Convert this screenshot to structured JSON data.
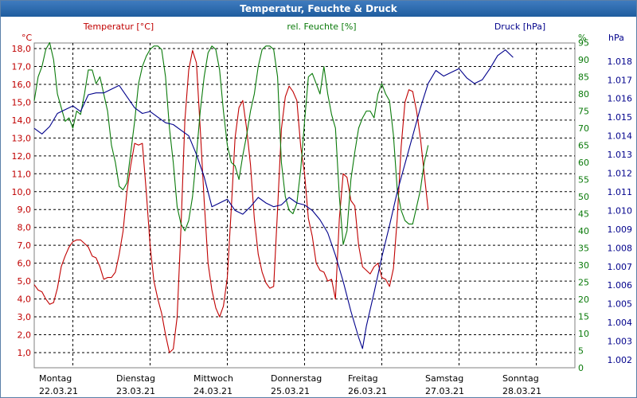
{
  "window": {
    "title": "Temperatur, Feuchte & Druck"
  },
  "colors": {
    "temp": "#c00000",
    "hum": "#0a7a0a",
    "press": "#00008b",
    "grid": "#000000"
  },
  "chart_data": {
    "type": "line",
    "title": "Temperatur, Feuchte & Druck",
    "grid": true,
    "x_range": [
      0,
      7
    ],
    "x_ticks": [
      {
        "day": "Montag",
        "date": "22.03.21",
        "x": 0
      },
      {
        "day": "Dienstag",
        "date": "23.03.21",
        "x": 1
      },
      {
        "day": "Mittwoch",
        "date": "24.03.21",
        "x": 2
      },
      {
        "day": "Donnerstag",
        "date": "25.03.21",
        "x": 3
      },
      {
        "day": "Freitag",
        "date": "26.03.21",
        "x": 4
      },
      {
        "day": "Samstag",
        "date": "27.03.21",
        "x": 5
      },
      {
        "day": "Sonntag",
        "date": "28.03.21",
        "x": 6
      }
    ],
    "axes": {
      "temp": {
        "unit": "°C",
        "label": "Temperatur [°C]",
        "range": [
          0.5,
          18.5
        ],
        "ticks": [
          "1,0",
          "2,0",
          "3,0",
          "4,0",
          "5,0",
          "6,0",
          "7,0",
          "8,0",
          "9,0",
          "10,0",
          "11,0",
          "12,0",
          "13,0",
          "14,0",
          "15,0",
          "16,0",
          "17,0",
          "18,0"
        ]
      },
      "hum": {
        "unit": "%",
        "label": "rel. Feuchte [%]",
        "range": [
          0,
          97
        ],
        "ticks": [
          "0",
          "5",
          "10",
          "15",
          "20",
          "25",
          "30",
          "35",
          "40",
          "45",
          "50",
          "55",
          "60",
          "65",
          "70",
          "75",
          "80",
          "85",
          "90",
          "95"
        ]
      },
      "press": {
        "unit": "hPa",
        "label": "Druck [hPa]",
        "range": [
          1001.6,
          1019.4
        ],
        "ticks": [
          "1.002",
          "1.003",
          "1.004",
          "1.005",
          "1.006",
          "1.007",
          "1.008",
          "1.009",
          "1.010",
          "1.011",
          "1.012",
          "1.013",
          "1.014",
          "1.015",
          "1.016",
          "1.017",
          "1.018"
        ]
      }
    },
    "series": [
      {
        "name": "Temperatur [°C]",
        "axis": "temp",
        "points": [
          [
            0,
            4.8
          ],
          [
            0.05,
            4.5
          ],
          [
            0.1,
            4.4
          ],
          [
            0.15,
            4.0
          ],
          [
            0.2,
            3.7
          ],
          [
            0.25,
            3.8
          ],
          [
            0.3,
            4.6
          ],
          [
            0.35,
            5.8
          ],
          [
            0.4,
            6.4
          ],
          [
            0.45,
            6.9
          ],
          [
            0.5,
            7.2
          ],
          [
            0.55,
            7.3
          ],
          [
            0.6,
            7.3
          ],
          [
            0.65,
            7.1
          ],
          [
            0.7,
            6.9
          ],
          [
            0.75,
            6.4
          ],
          [
            0.8,
            6.3
          ],
          [
            0.85,
            5.8
          ],
          [
            0.9,
            5.1
          ],
          [
            0.95,
            5.2
          ],
          [
            1.0,
            5.2
          ],
          [
            1.05,
            5.5
          ],
          [
            1.1,
            6.5
          ],
          [
            1.15,
            7.8
          ],
          [
            1.2,
            10.0
          ],
          [
            1.25,
            11.5
          ],
          [
            1.3,
            12.7
          ],
          [
            1.35,
            12.6
          ],
          [
            1.4,
            12.7
          ],
          [
            1.45,
            10.0
          ],
          [
            1.5,
            7.0
          ],
          [
            1.55,
            5.0
          ],
          [
            1.6,
            4.0
          ],
          [
            1.65,
            3.2
          ],
          [
            1.7,
            2.0
          ],
          [
            1.75,
            1.0
          ],
          [
            1.8,
            1.2
          ],
          [
            1.85,
            3.0
          ],
          [
            1.9,
            8.0
          ],
          [
            1.95,
            14.0
          ],
          [
            2.0,
            16.8
          ],
          [
            2.05,
            17.9
          ],
          [
            2.1,
            17.2
          ],
          [
            2.15,
            13.5
          ],
          [
            2.2,
            9.5
          ],
          [
            2.25,
            6.0
          ],
          [
            2.3,
            4.5
          ],
          [
            2.35,
            3.5
          ],
          [
            2.4,
            3.0
          ],
          [
            2.45,
            3.6
          ],
          [
            2.5,
            5.2
          ],
          [
            2.55,
            9.0
          ],
          [
            2.6,
            13.0
          ],
          [
            2.65,
            14.7
          ],
          [
            2.7,
            15.1
          ],
          [
            2.75,
            13.5
          ],
          [
            2.8,
            11.5
          ],
          [
            2.85,
            8.5
          ],
          [
            2.9,
            6.5
          ],
          [
            2.95,
            5.5
          ],
          [
            3.0,
            4.9
          ],
          [
            3.05,
            4.6
          ],
          [
            3.1,
            4.7
          ],
          [
            3.15,
            9.0
          ],
          [
            3.2,
            13.5
          ],
          [
            3.25,
            15.3
          ],
          [
            3.3,
            15.9
          ],
          [
            3.35,
            15.6
          ],
          [
            3.4,
            15.1
          ],
          [
            3.45,
            12.5
          ],
          [
            3.5,
            11.0
          ],
          [
            3.55,
            8.5
          ],
          [
            3.6,
            7.5
          ],
          [
            3.65,
            6.0
          ],
          [
            3.7,
            5.6
          ],
          [
            3.75,
            5.5
          ],
          [
            3.8,
            5.0
          ],
          [
            3.85,
            5.1
          ],
          [
            3.9,
            4.0
          ],
          [
            3.95,
            8.5
          ],
          [
            4.0,
            11.0
          ],
          [
            4.05,
            10.8
          ],
          [
            4.1,
            9.5
          ],
          [
            4.15,
            9.2
          ],
          [
            4.2,
            7.0
          ],
          [
            4.25,
            5.8
          ],
          [
            4.3,
            5.6
          ],
          [
            4.35,
            5.4
          ],
          [
            4.4,
            5.8
          ],
          [
            4.45,
            6.0
          ],
          [
            4.5,
            5.2
          ],
          [
            4.55,
            5.1
          ],
          [
            4.6,
            4.7
          ],
          [
            4.65,
            5.7
          ],
          [
            4.7,
            8.5
          ],
          [
            4.75,
            12.5
          ],
          [
            4.8,
            15.0
          ],
          [
            4.85,
            15.7
          ],
          [
            4.9,
            15.6
          ],
          [
            4.95,
            14.5
          ],
          [
            5.0,
            13.0
          ],
          [
            5.05,
            11.0
          ],
          [
            5.1,
            9.0
          ]
        ]
      },
      {
        "name": "rel. Feuchte [%]",
        "axis": "hum",
        "points": [
          [
            0,
            78
          ],
          [
            0.05,
            85
          ],
          [
            0.1,
            88
          ],
          [
            0.15,
            93
          ],
          [
            0.2,
            95
          ],
          [
            0.25,
            90
          ],
          [
            0.3,
            80
          ],
          [
            0.35,
            76
          ],
          [
            0.4,
            72
          ],
          [
            0.45,
            73
          ],
          [
            0.5,
            70
          ],
          [
            0.55,
            75
          ],
          [
            0.6,
            74
          ],
          [
            0.65,
            80
          ],
          [
            0.7,
            87
          ],
          [
            0.75,
            87
          ],
          [
            0.8,
            83
          ],
          [
            0.85,
            85
          ],
          [
            0.9,
            80
          ],
          [
            0.95,
            75
          ],
          [
            1.0,
            65
          ],
          [
            1.05,
            60
          ],
          [
            1.1,
            53
          ],
          [
            1.15,
            52
          ],
          [
            1.2,
            54
          ],
          [
            1.25,
            63
          ],
          [
            1.3,
            72
          ],
          [
            1.35,
            83
          ],
          [
            1.4,
            88
          ],
          [
            1.45,
            91
          ],
          [
            1.5,
            93
          ],
          [
            1.55,
            94
          ],
          [
            1.6,
            94
          ],
          [
            1.65,
            93
          ],
          [
            1.7,
            85
          ],
          [
            1.75,
            70
          ],
          [
            1.8,
            60
          ],
          [
            1.85,
            47
          ],
          [
            1.9,
            42
          ],
          [
            1.95,
            40
          ],
          [
            2.0,
            43
          ],
          [
            2.05,
            50
          ],
          [
            2.1,
            62
          ],
          [
            2.15,
            75
          ],
          [
            2.2,
            85
          ],
          [
            2.25,
            92
          ],
          [
            2.3,
            94
          ],
          [
            2.35,
            93
          ],
          [
            2.4,
            87
          ],
          [
            2.45,
            75
          ],
          [
            2.5,
            65
          ],
          [
            2.55,
            60
          ],
          [
            2.6,
            59
          ],
          [
            2.65,
            55
          ],
          [
            2.7,
            62
          ],
          [
            2.75,
            68
          ],
          [
            2.8,
            75
          ],
          [
            2.85,
            80
          ],
          [
            2.9,
            88
          ],
          [
            2.95,
            93
          ],
          [
            3.0,
            94
          ],
          [
            3.05,
            94
          ],
          [
            3.1,
            93
          ],
          [
            3.15,
            85
          ],
          [
            3.2,
            60
          ],
          [
            3.25,
            50
          ],
          [
            3.3,
            46
          ],
          [
            3.35,
            45
          ],
          [
            3.4,
            48
          ],
          [
            3.45,
            58
          ],
          [
            3.5,
            72
          ],
          [
            3.55,
            85
          ],
          [
            3.6,
            86
          ],
          [
            3.65,
            83
          ],
          [
            3.7,
            80
          ],
          [
            3.75,
            88
          ],
          [
            3.8,
            80
          ],
          [
            3.85,
            74
          ],
          [
            3.9,
            70
          ],
          [
            3.95,
            50
          ],
          [
            4.0,
            36
          ],
          [
            4.05,
            40
          ],
          [
            4.1,
            55
          ],
          [
            4.15,
            63
          ],
          [
            4.2,
            70
          ],
          [
            4.25,
            73
          ],
          [
            4.3,
            75
          ],
          [
            4.35,
            75
          ],
          [
            4.4,
            73
          ],
          [
            4.45,
            80
          ],
          [
            4.5,
            83
          ],
          [
            4.55,
            80
          ],
          [
            4.6,
            78
          ],
          [
            4.65,
            68
          ],
          [
            4.7,
            52
          ],
          [
            4.75,
            46
          ],
          [
            4.8,
            43
          ],
          [
            4.85,
            42
          ],
          [
            4.9,
            42
          ],
          [
            4.95,
            47
          ],
          [
            5.0,
            52
          ],
          [
            5.05,
            60
          ],
          [
            5.1,
            65
          ]
        ]
      },
      {
        "name": "Druck [hPa]",
        "axis": "press",
        "points": [
          [
            0,
            1014.4
          ],
          [
            0.1,
            1014.1
          ],
          [
            0.2,
            1014.5
          ],
          [
            0.3,
            1015.2
          ],
          [
            0.4,
            1015.4
          ],
          [
            0.5,
            1015.6
          ],
          [
            0.6,
            1015.3
          ],
          [
            0.7,
            1016.2
          ],
          [
            0.8,
            1016.3
          ],
          [
            0.9,
            1016.3
          ],
          [
            1.0,
            1016.5
          ],
          [
            1.1,
            1016.7
          ],
          [
            1.2,
            1016.1
          ],
          [
            1.3,
            1015.5
          ],
          [
            1.4,
            1015.2
          ],
          [
            1.5,
            1015.3
          ],
          [
            1.6,
            1015.0
          ],
          [
            1.7,
            1014.7
          ],
          [
            1.8,
            1014.6
          ],
          [
            1.9,
            1014.3
          ],
          [
            2.0,
            1014.0
          ],
          [
            2.1,
            1013.0
          ],
          [
            2.2,
            1011.8
          ],
          [
            2.3,
            1010.2
          ],
          [
            2.4,
            1010.4
          ],
          [
            2.5,
            1010.6
          ],
          [
            2.6,
            1010.0
          ],
          [
            2.7,
            1009.8
          ],
          [
            2.8,
            1010.2
          ],
          [
            2.9,
            1010.7
          ],
          [
            3.0,
            1010.4
          ],
          [
            3.1,
            1010.2
          ],
          [
            3.2,
            1010.3
          ],
          [
            3.3,
            1010.7
          ],
          [
            3.4,
            1010.4
          ],
          [
            3.5,
            1010.3
          ],
          [
            3.6,
            1010.0
          ],
          [
            3.7,
            1009.5
          ],
          [
            3.8,
            1008.8
          ],
          [
            3.9,
            1007.6
          ],
          [
            4.0,
            1006.2
          ],
          [
            4.1,
            1004.6
          ],
          [
            4.2,
            1003.2
          ],
          [
            4.25,
            1002.6
          ],
          [
            4.3,
            1003.8
          ],
          [
            4.4,
            1005.6
          ],
          [
            4.5,
            1007.5
          ],
          [
            4.6,
            1009.2
          ],
          [
            4.7,
            1011.0
          ],
          [
            4.8,
            1012.5
          ],
          [
            4.9,
            1014.0
          ],
          [
            5.0,
            1015.5
          ],
          [
            5.1,
            1016.8
          ],
          [
            5.2,
            1017.5
          ],
          [
            5.3,
            1017.2
          ],
          [
            5.4,
            1017.4
          ],
          [
            5.5,
            1017.6
          ],
          [
            5.6,
            1017.1
          ],
          [
            5.7,
            1016.8
          ],
          [
            5.8,
            1017.0
          ],
          [
            5.9,
            1017.6
          ],
          [
            6.0,
            1018.3
          ],
          [
            6.1,
            1018.6
          ],
          [
            6.2,
            1018.2
          ]
        ]
      }
    ]
  }
}
